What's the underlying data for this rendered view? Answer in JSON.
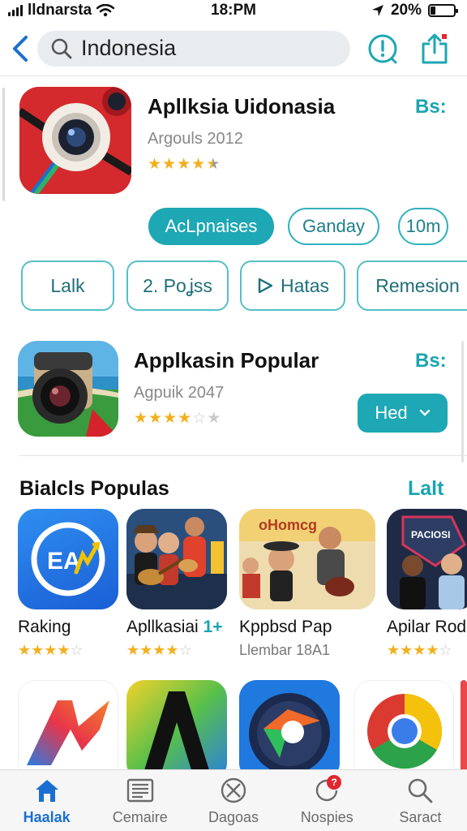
{
  "status": {
    "carrier": "lldnarsta",
    "time": "18:PM",
    "battery": "20%",
    "battery_level": 0.2
  },
  "search": {
    "query": "Indonesia"
  },
  "featured_app": {
    "title": "Apllksia Uidonasia",
    "subtitle": "Argouls 2012",
    "rating": 4.5,
    "stars": "★★★★★",
    "price": "Bs:"
  },
  "chips": [
    "AcLpnaises",
    "Ganday",
    "10m"
  ],
  "pills": [
    "Lalk",
    "2. Poʝss",
    "Hatas",
    "Remesion"
  ],
  "popular_app": {
    "title": "Applkasin Popular",
    "subtitle": "Agpuik 2047",
    "rating": 3.5,
    "price": "Bs:",
    "button": "Hed"
  },
  "section": {
    "title": "Bialcls Populas",
    "link": "Lalt"
  },
  "cards": [
    {
      "name": "Raking",
      "badge": "",
      "rating": 3.5,
      "sub": ""
    },
    {
      "name": "Apllkasiai",
      "badge": "1+",
      "rating": 4,
      "sub": ""
    },
    {
      "name": "Kppbsd Pap",
      "badge": "",
      "rating": 0,
      "sub": "Llembar 18A1"
    },
    {
      "name": "Apilar Roda",
      "badge": "",
      "rating": 4.5,
      "sub": ""
    }
  ],
  "tabs": [
    "Haalak",
    "Cemaire",
    "Dagoas",
    "Nospies",
    "Saract"
  ],
  "tab_badge": "?",
  "colors": {
    "accent": "#1ea7b4",
    "link_blue": "#1a6fd1",
    "star": "#f2b01e"
  }
}
